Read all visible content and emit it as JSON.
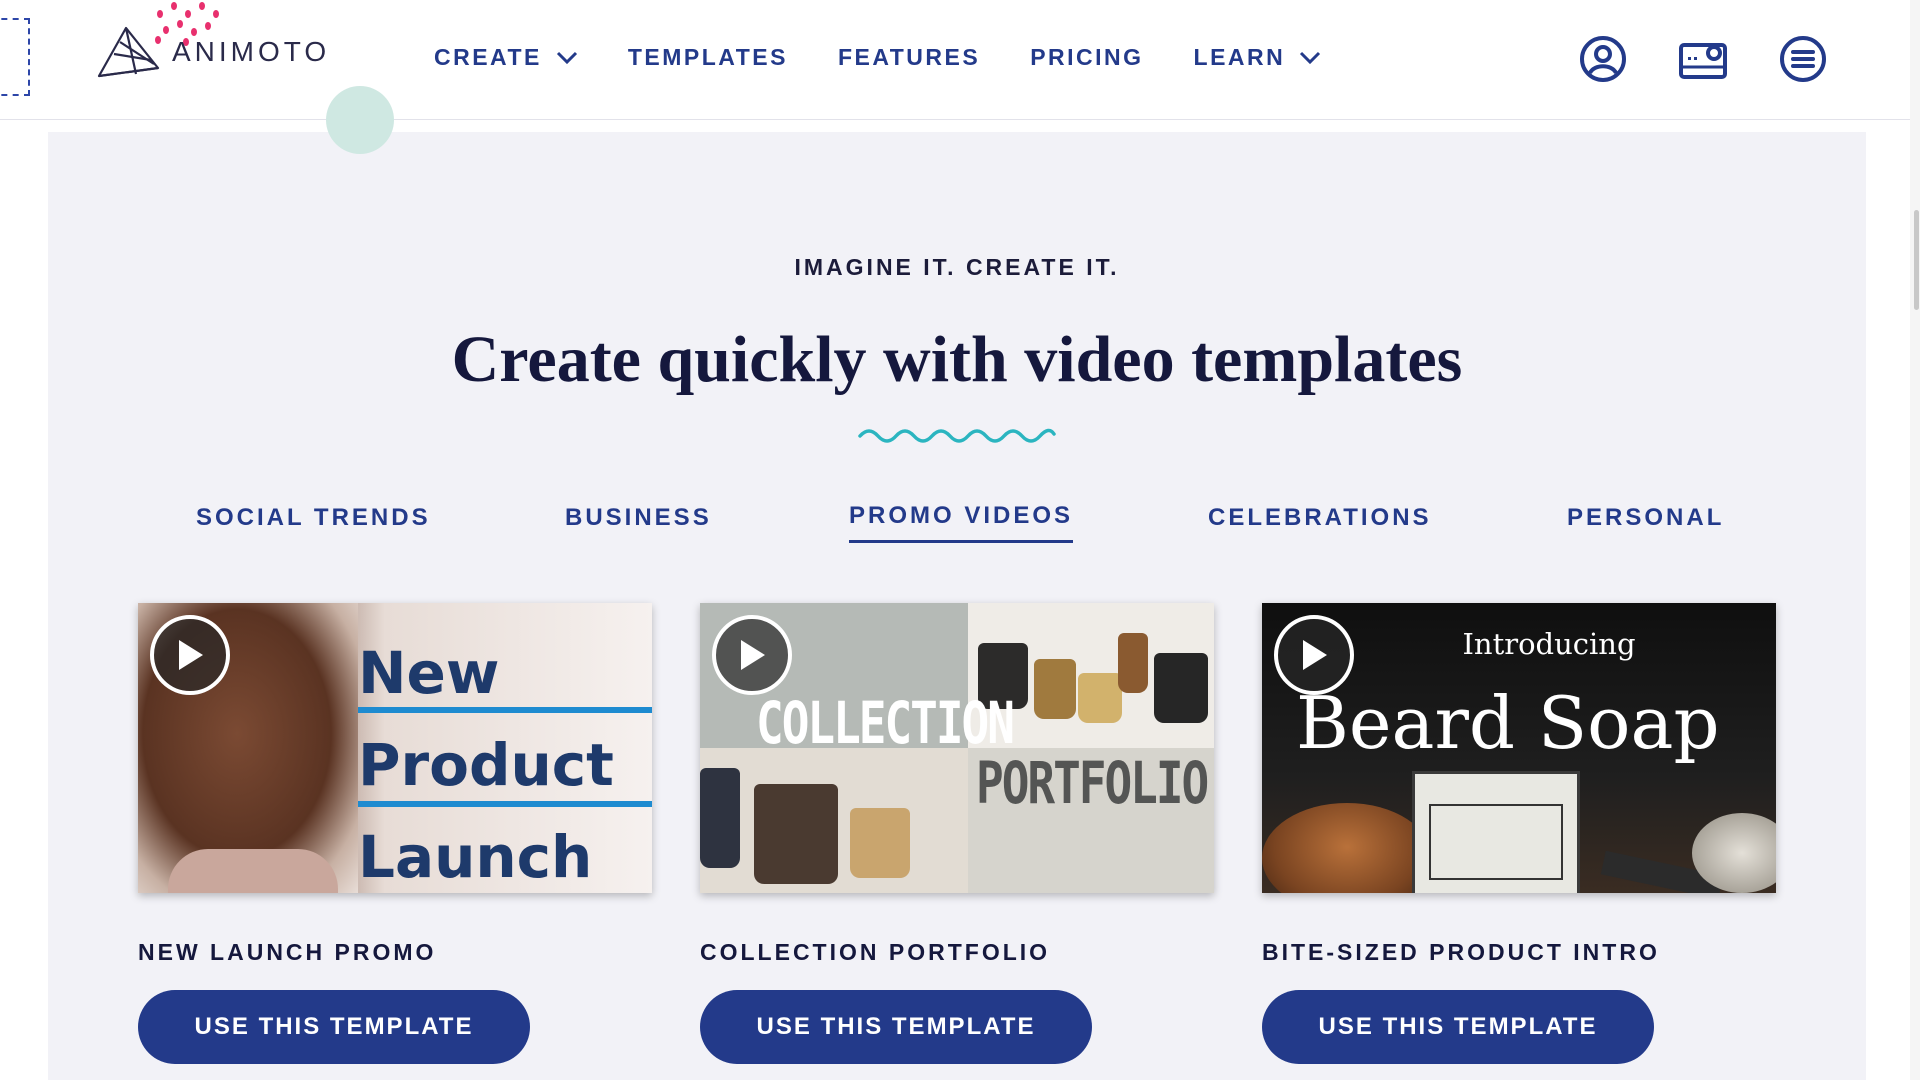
{
  "header": {
    "logo_text": "ANIMOTO",
    "nav": [
      {
        "label": "CREATE",
        "has_dropdown": true
      },
      {
        "label": "TEMPLATES",
        "has_dropdown": false
      },
      {
        "label": "FEATURES",
        "has_dropdown": false
      },
      {
        "label": "PRICING",
        "has_dropdown": false
      },
      {
        "label": "LEARN",
        "has_dropdown": true
      }
    ],
    "icons": [
      "account-icon",
      "gallery-icon",
      "menu-icon"
    ]
  },
  "section": {
    "eyebrow": "IMAGINE IT. CREATE IT.",
    "headline": "Create quickly with video templates",
    "tabs": [
      {
        "label": "SOCIAL TRENDS",
        "active": false
      },
      {
        "label": "BUSINESS",
        "active": false
      },
      {
        "label": "PROMO VIDEOS",
        "active": true
      },
      {
        "label": "CELEBRATIONS",
        "active": false
      },
      {
        "label": "PERSONAL",
        "active": false
      }
    ],
    "cards": [
      {
        "title": "NEW LAUNCH PROMO",
        "cta": "USE THIS TEMPLATE",
        "thumb_lines": [
          "New",
          "Product",
          "Launch"
        ]
      },
      {
        "title": "COLLECTION PORTFOLIO",
        "cta": "USE THIS TEMPLATE",
        "thumb_lines": [
          "COLLECTION",
          "PORTFOLIO"
        ]
      },
      {
        "title": "BITE-SIZED PRODUCT INTRO",
        "cta": "USE THIS TEMPLATE",
        "thumb_lines": [
          "Introducing",
          "Beard Soap"
        ]
      }
    ]
  },
  "colors": {
    "brand_navy": "#233a8a",
    "heading": "#15183d",
    "section_bg": "#f2f2f7",
    "accent_teal": "#2bb5c0"
  }
}
